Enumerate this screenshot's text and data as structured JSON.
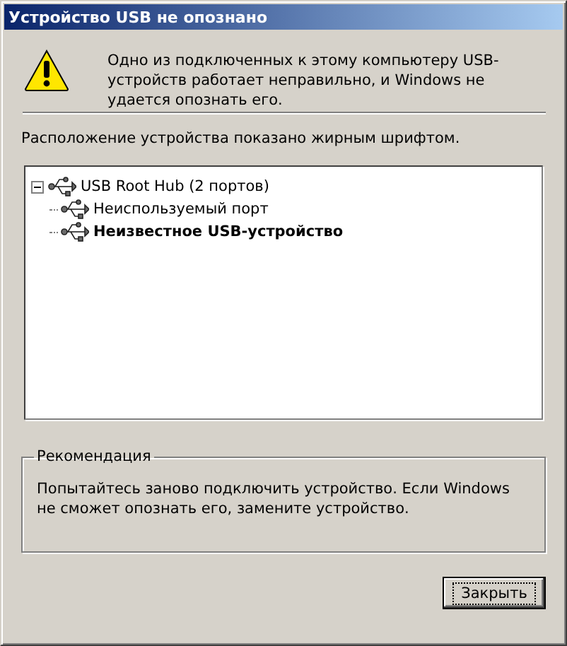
{
  "window": {
    "title": "Устройство USB не опознано"
  },
  "message": {
    "text": "Одно из подключенных к этому компьютеру USB-устройств работает неправильно, и Windows не удается опознать его."
  },
  "tree_label": "Расположение устройства показано жирным шрифтом.",
  "tree": [
    {
      "label": "USB Root Hub (2 портов)",
      "expanded": true,
      "bold": false,
      "children": [
        {
          "label": "Неиспользуемый порт",
          "bold": false
        },
        {
          "label": "Неизвестное USB-устройство",
          "bold": true
        }
      ]
    }
  ],
  "recommendation": {
    "title": "Рекомендация",
    "text": "Попытайтесь заново подключить устройство. Если Windows не сможет опознать его, замените устройство."
  },
  "buttons": [
    {
      "label": "Закрыть",
      "focused": true
    }
  ]
}
